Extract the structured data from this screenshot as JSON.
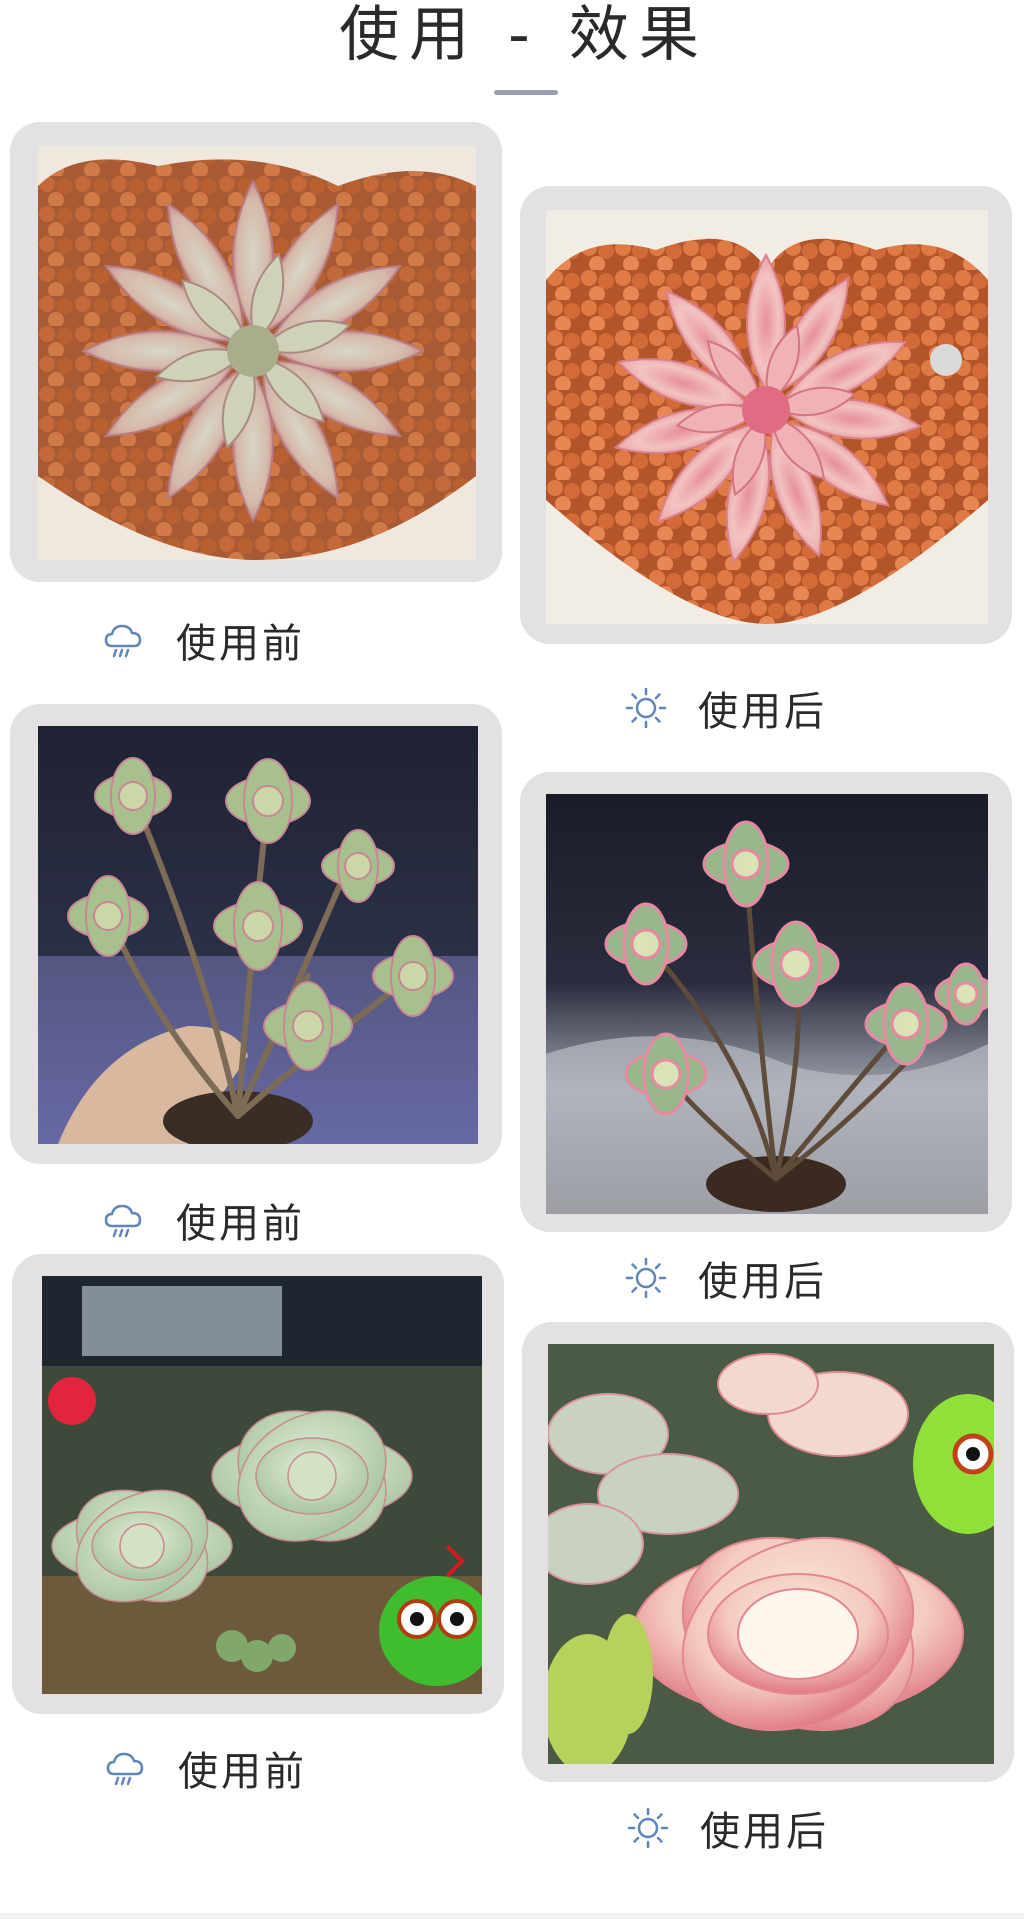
{
  "page": {
    "title": "使用 - 效果"
  },
  "pairs": [
    {
      "before": {
        "label": "使用前",
        "icon": "rain-cloud-icon",
        "subject": "echeveria-rosette-heart-pot"
      },
      "after": {
        "label": "使用后",
        "icon": "sun-icon",
        "subject": "pink-echeveria-rosette-heart-pot"
      }
    },
    {
      "before": {
        "label": "使用前",
        "icon": "rain-cloud-icon",
        "subject": "branching-succulent-green"
      },
      "after": {
        "label": "使用后",
        "icon": "sun-icon",
        "subject": "branching-succulent-pink-edges"
      }
    },
    {
      "before": {
        "label": "使用前",
        "icon": "rain-cloud-icon",
        "subject": "green-echeveria-with-frog-toy"
      },
      "after": {
        "label": "使用后",
        "icon": "sun-icon",
        "subject": "pink-echeveria-with-frog-toy"
      }
    }
  ],
  "colors": {
    "frame": "#e3e1e1",
    "icon": "#5e86b8",
    "underline": "#9aa0b2",
    "text": "#2a2a2a"
  }
}
